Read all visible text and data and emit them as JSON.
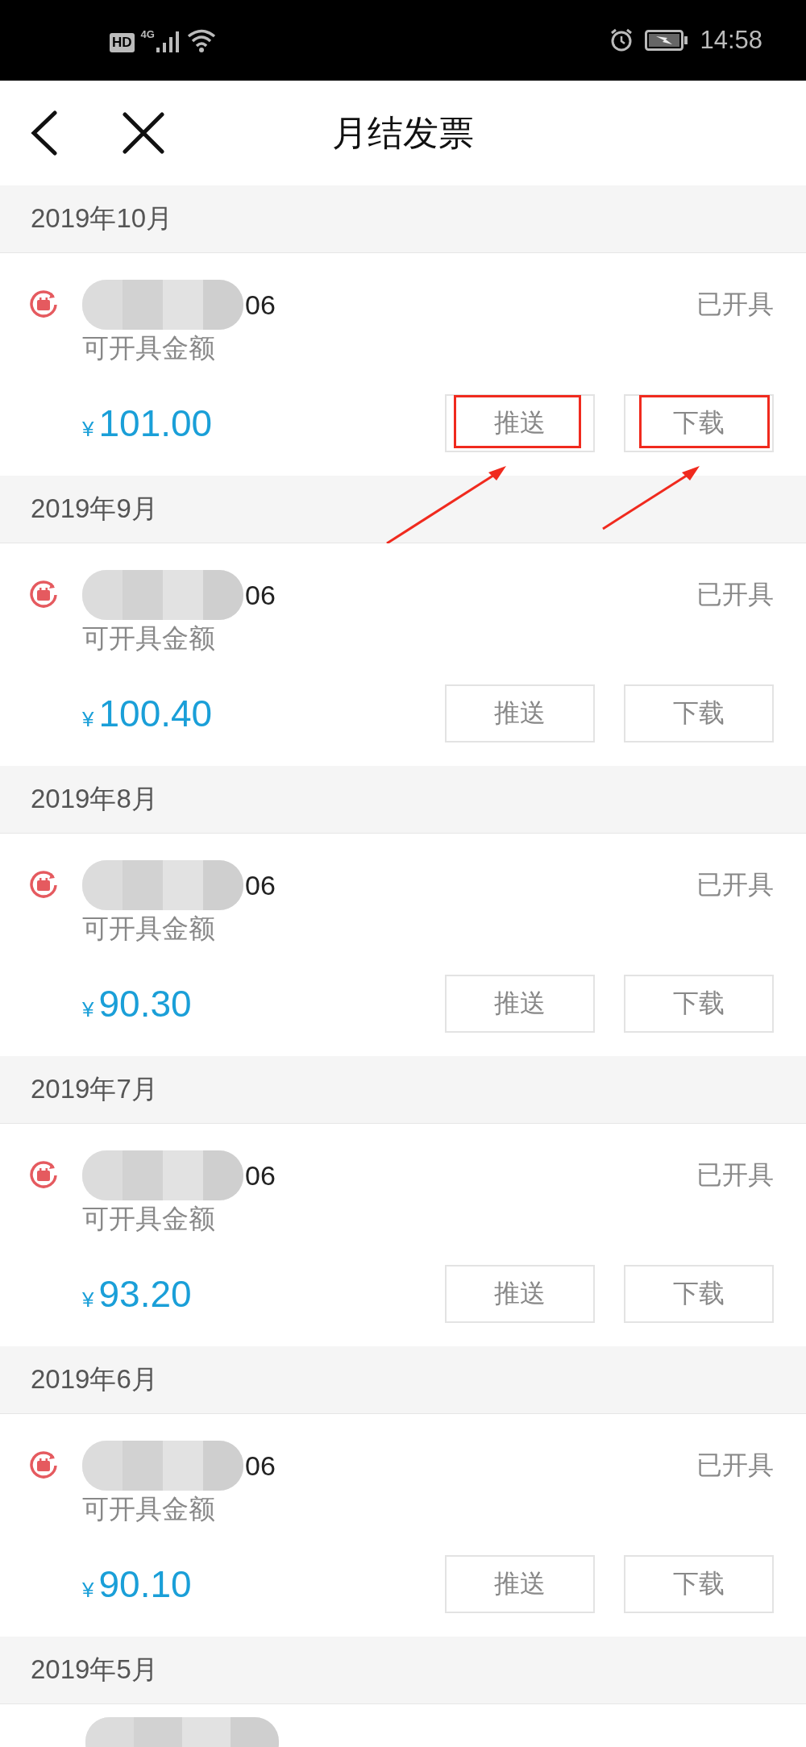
{
  "status_bar": {
    "hd": "HD",
    "network": "4G",
    "time": "14:58"
  },
  "header": {
    "title": "月结发票"
  },
  "months": [
    {
      "label": "2019年10月",
      "invoice": {
        "number_tail": "06",
        "status": "已开具",
        "amount_label": "可开具金额",
        "currency": "¥",
        "amount": "101.00",
        "buttons": [
          "推送",
          "下载"
        ],
        "annotated": true
      }
    },
    {
      "label": "2019年9月",
      "invoice": {
        "number_tail": "06",
        "status": "已开具",
        "amount_label": "可开具金额",
        "currency": "¥",
        "amount": "100.40",
        "buttons": [
          "推送",
          "下载"
        ],
        "annotated": false
      }
    },
    {
      "label": "2019年8月",
      "invoice": {
        "number_tail": "06",
        "status": "已开具",
        "amount_label": "可开具金额",
        "currency": "¥",
        "amount": "90.30",
        "buttons": [
          "推送",
          "下载"
        ],
        "annotated": false
      }
    },
    {
      "label": "2019年7月",
      "invoice": {
        "number_tail": "06",
        "status": "已开具",
        "amount_label": "可开具金额",
        "currency": "¥",
        "amount": "93.20",
        "buttons": [
          "推送",
          "下载"
        ],
        "annotated": false
      }
    },
    {
      "label": "2019年6月",
      "invoice": {
        "number_tail": "06",
        "status": "已开具",
        "amount_label": "可开具金额",
        "currency": "¥",
        "amount": "90.10",
        "buttons": [
          "推送",
          "下载"
        ],
        "annotated": false
      }
    },
    {
      "label": "2019年5月"
    }
  ]
}
